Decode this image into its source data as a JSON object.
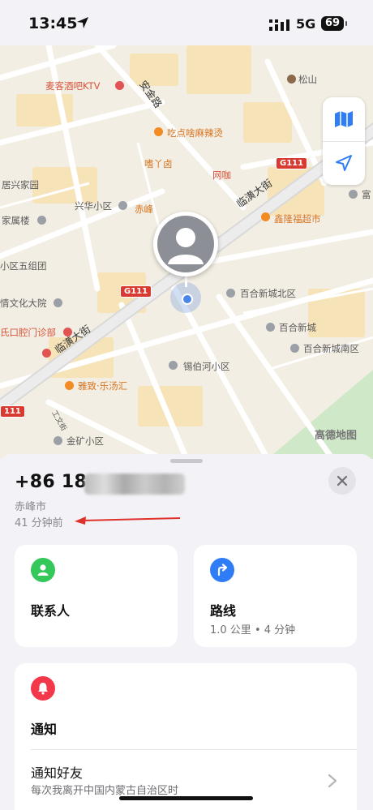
{
  "status_bar": {
    "time": "13:45",
    "network": "5G",
    "battery": "69"
  },
  "map": {
    "labels": {
      "ktv": "麦客酒吧KTV",
      "songshan": "松山",
      "anjin": "安金路",
      "chidian": "吃点啥麻辣烫",
      "hengyalu": "嗜丫卤",
      "wangka": "网咖",
      "juxing": "居兴家园",
      "xinghua": "兴华小区",
      "chifeng_short": "赤峰",
      "jiashu": "家属楼",
      "wuzu": "小区五组团",
      "qingwen": "情文化大院",
      "kouqiang": "氏口腔门诊部",
      "linhuang1": "临潢大街",
      "linhuang2": "临潢大街",
      "xinding": "鑫隆福超市",
      "fu": "富",
      "baihe_north": "百合新城北区",
      "baihe": "百合新城",
      "baihe_south": "百合新城南区",
      "xiboh": "锡伯河小区",
      "yazhi": "雅致·乐汤汇",
      "gongwen": "工文街",
      "jinkuang": "金矿小区",
      "gaode": "高德地图",
      "g111a": "G111",
      "g111b": "G111",
      "g111c": "111"
    }
  },
  "contact": {
    "phone_prefix": "+86 18",
    "city": "赤峰市",
    "last_seen": "41 分钟前"
  },
  "cards": {
    "contacts": {
      "title": "联系人"
    },
    "route": {
      "title": "路线",
      "subtitle": "1.0 公里 • 4 分钟"
    },
    "notify": {
      "title": "通知",
      "row_title": "通知好友",
      "row_subtitle": "每次我离开中国内蒙古自治区时"
    }
  },
  "icons": {
    "map_toggle": "map-icon",
    "locate": "location-arrow-icon",
    "close": "close-icon",
    "contacts": "person-icon",
    "route": "turn-arrow-icon",
    "notify": "bell-icon",
    "chevron": "chevron-right-icon"
  },
  "colors": {
    "accent_blue": "#2f7df6",
    "green": "#34c759",
    "red": "#f2384a",
    "arrow_red": "#e0322b"
  }
}
